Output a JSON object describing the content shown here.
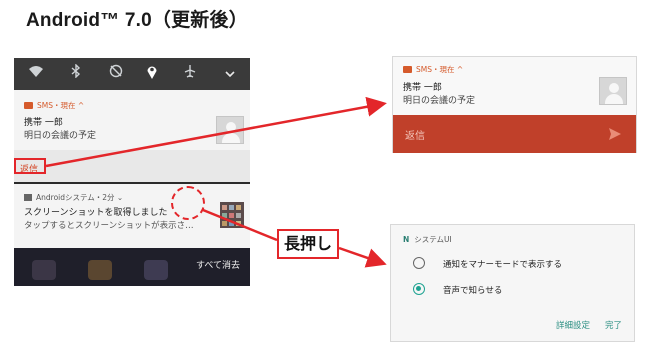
{
  "title": "Android™ 7.0（更新後）",
  "colors": {
    "accent_red": "#e3262a",
    "sms_orange": "#d55a2b",
    "reply_bar": "#c0402a",
    "teal": "#1fa392"
  },
  "phone": {
    "status_icons": [
      "wifi-icon",
      "bluetooth-icon",
      "no-disturb-icon",
      "location-icon",
      "airplane-icon",
      "chevron-down-icon"
    ],
    "notification_sms": {
      "app_line": "SMS・現在 ^",
      "title": "携帯 一郎",
      "text": "明日の会議の予定",
      "reply": "返信"
    },
    "notification_system": {
      "app_line": "Androidシステム・2分 ⌄",
      "title": "スクリーンショットを取得しました",
      "text": "タップするとスクリーンショットが表示さ…"
    },
    "clear_all": "すべて消去"
  },
  "callout": {
    "long_press": "長押し"
  },
  "reply_panel": {
    "app_line": "SMS・現在 ^",
    "title": "携帯 一郎",
    "text": "明日の会議の予定",
    "reply_placeholder": "返信"
  },
  "settings_panel": {
    "app_line": "システムUI",
    "options": [
      {
        "label": "通知をマナーモードで表示する",
        "selected": false
      },
      {
        "label": "音声で知らせる",
        "selected": true
      }
    ],
    "detail_button": "詳細設定",
    "done_button": "完了"
  }
}
